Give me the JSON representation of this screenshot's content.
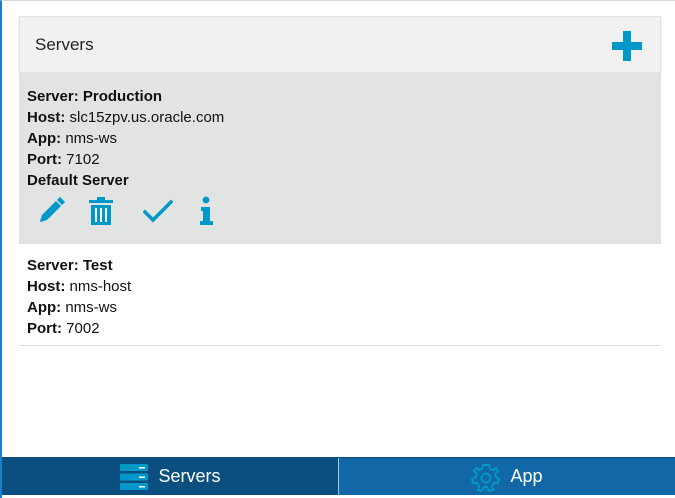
{
  "panel": {
    "title": "Servers",
    "add_icon": "plus-icon"
  },
  "servers": [
    {
      "server_label": "Server:",
      "server_value": "Production",
      "host_label": "Host:",
      "host_value": "slc15zpv.us.oracle.com",
      "app_label": "App:",
      "app_value": "nms-ws",
      "port_label": "Port:",
      "port_value": "7102",
      "default_label": "Default Server",
      "selected": true
    },
    {
      "server_label": "Server:",
      "server_value": "Test",
      "host_label": "Host:",
      "host_value": "nms-host",
      "app_label": "App:",
      "app_value": "nms-ws",
      "port_label": "Port:",
      "port_value": "7002",
      "selected": false
    }
  ],
  "actions": [
    {
      "icon": "pencil-icon"
    },
    {
      "icon": "trash-icon"
    },
    {
      "icon": "checkmark-icon"
    },
    {
      "icon": "info-icon"
    }
  ],
  "tabs": [
    {
      "label": "Servers",
      "icon": "servers-icon",
      "active": true
    },
    {
      "label": "App",
      "icon": "gear-icon",
      "active": false
    }
  ],
  "colors": {
    "accent": "#0097c9",
    "tab_active": "#0b4f80",
    "tab_inactive": "#1268a7",
    "selected_row": "#e2e3e3"
  }
}
